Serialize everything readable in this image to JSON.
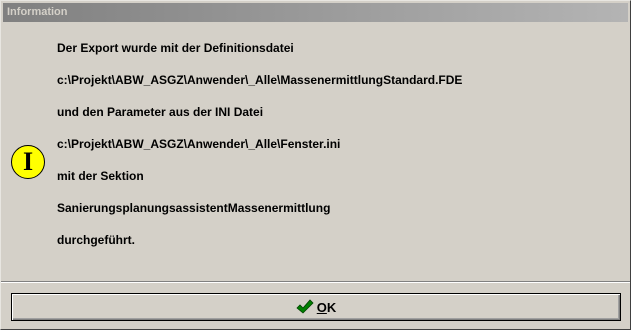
{
  "window": {
    "title": "Information"
  },
  "message": {
    "lines": [
      "Der Export wurde mit der Definitionsdatei",
      "c:\\Projekt\\ABW_ASGZ\\Anwender\\_Alle\\MassenermittlungStandard.FDE",
      "und den Parameter aus der INI Datei",
      "c:\\Projekt\\ABW_ASGZ\\Anwender\\_Alle\\Fenster.ini",
      "mit der Sektion",
      "SanierungsplanungsassistentMassenermittlung",
      "durchgeführt."
    ]
  },
  "icon": {
    "name": "information-icon",
    "glyph": "I",
    "color": "#ffff00"
  },
  "buttons": {
    "ok": {
      "mnemonic": "O",
      "rest": "K",
      "icon": "checkmark-icon",
      "icon_color": "#008000"
    }
  },
  "colors": {
    "dialog_bg": "#d4d0c8",
    "titlebar_start": "#808080",
    "titlebar_end": "#b4b4b4"
  }
}
